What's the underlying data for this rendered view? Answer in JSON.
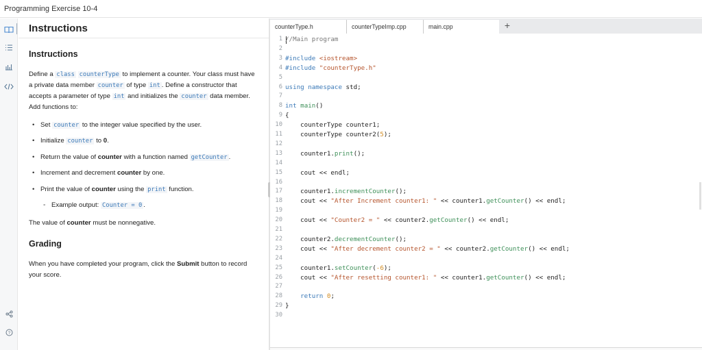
{
  "window": {
    "title": "Programming Exercise 10-4"
  },
  "instructions": {
    "panel_title": "Instructions",
    "heading": "Instructions",
    "intro": [
      {
        "t": "Define a "
      },
      {
        "c": "class"
      },
      {
        "t": " "
      },
      {
        "c": "counterType"
      },
      {
        "t": " to implement a counter. Your class must have a private data member "
      },
      {
        "c": "counter"
      },
      {
        "t": " of type "
      },
      {
        "c": "int"
      },
      {
        "t": ". Define a constructor that accepts a parameter of type "
      },
      {
        "c": "int"
      },
      {
        "t": " and initializes the "
      },
      {
        "c": "counter"
      },
      {
        "t": " data member. Add functions to:"
      }
    ],
    "bullets": [
      {
        "sub": false,
        "parts": [
          {
            "t": "Set "
          },
          {
            "c": "counter"
          },
          {
            "t": " to the integer value specified by the user."
          }
        ]
      },
      {
        "sub": false,
        "parts": [
          {
            "t": "Initialize "
          },
          {
            "c": "counter"
          },
          {
            "t": " to "
          },
          {
            "b": "0"
          },
          {
            "t": "."
          }
        ]
      },
      {
        "sub": false,
        "parts": [
          {
            "t": "Return the value of "
          },
          {
            "b": "counter"
          },
          {
            "t": " with a function named "
          },
          {
            "c": "getCounter"
          },
          {
            "t": "."
          }
        ]
      },
      {
        "sub": false,
        "parts": [
          {
            "t": "Increment and decrement "
          },
          {
            "b": "counter"
          },
          {
            "t": " by one."
          }
        ]
      },
      {
        "sub": false,
        "parts": [
          {
            "t": "Print the value of "
          },
          {
            "b": "counter"
          },
          {
            "t": " using the "
          },
          {
            "c": "print"
          },
          {
            "t": " function."
          }
        ]
      },
      {
        "sub": true,
        "parts": [
          {
            "t": "Example output: "
          },
          {
            "c": "Counter = 0"
          },
          {
            "t": "."
          }
        ]
      }
    ],
    "note": [
      {
        "t": "The value of "
      },
      {
        "b": "counter"
      },
      {
        "t": " must be nonnegative."
      }
    ],
    "grading_heading": "Grading",
    "grading": [
      {
        "t": "When you have completed your program, click the "
      },
      {
        "b": "Submit"
      },
      {
        "t": " button to record your score."
      }
    ]
  },
  "editor": {
    "tabs": [
      {
        "label": "counterType.h",
        "active": false
      },
      {
        "label": "counterTypeImp.cpp",
        "active": false
      },
      {
        "label": "main.cpp",
        "active": true
      }
    ],
    "add_tab_label": "+",
    "lines": [
      [
        [
          "cmt",
          "//Main program"
        ]
      ],
      [],
      [
        [
          "pp",
          "#include "
        ],
        [
          "str",
          "<iostream>"
        ]
      ],
      [
        [
          "pp",
          "#include "
        ],
        [
          "str",
          "\"counterType.h\""
        ]
      ],
      [],
      [
        [
          "kw",
          "using namespace"
        ],
        [
          "",
          " std;"
        ]
      ],
      [],
      [
        [
          "kw",
          "int"
        ],
        [
          "",
          " "
        ],
        [
          "fn",
          "main"
        ],
        [
          "",
          "()"
        ]
      ],
      [
        [
          "",
          "{"
        ]
      ],
      [
        [
          "",
          "    counterType counter1;"
        ]
      ],
      [
        [
          "",
          "    counterType counter2("
        ],
        [
          "num",
          "5"
        ],
        [
          "",
          ");"
        ]
      ],
      [],
      [
        [
          "",
          "    counter1."
        ],
        [
          "fn",
          "print"
        ],
        [
          "",
          "();"
        ]
      ],
      [],
      [
        [
          "",
          "    cout << endl;"
        ]
      ],
      [],
      [
        [
          "",
          "    counter1."
        ],
        [
          "fn",
          "incrementCounter"
        ],
        [
          "",
          "();"
        ]
      ],
      [
        [
          "",
          "    cout << "
        ],
        [
          "str",
          "\"After Increment counter1: \""
        ],
        [
          "",
          " << counter1."
        ],
        [
          "fn",
          "getCounter"
        ],
        [
          "",
          "() << endl;"
        ]
      ],
      [],
      [
        [
          "",
          "    cout << "
        ],
        [
          "str",
          "\"Counter2 = \""
        ],
        [
          "",
          " << counter2."
        ],
        [
          "fn",
          "getCounter"
        ],
        [
          "",
          "() << endl;"
        ]
      ],
      [],
      [
        [
          "",
          "    counter2."
        ],
        [
          "fn",
          "decrementCounter"
        ],
        [
          "",
          "();"
        ]
      ],
      [
        [
          "",
          "    cout << "
        ],
        [
          "str",
          "\"After decrement counter2 = \""
        ],
        [
          "",
          " << counter2."
        ],
        [
          "fn",
          "getCounter"
        ],
        [
          "",
          "() << endl;"
        ]
      ],
      [],
      [
        [
          "",
          "    counter1."
        ],
        [
          "fn",
          "setCounter"
        ],
        [
          "",
          "("
        ],
        [
          "num",
          "-6"
        ],
        [
          "",
          ");"
        ]
      ],
      [
        [
          "",
          "    cout << "
        ],
        [
          "str",
          "\"After resetting counter1: \""
        ],
        [
          "",
          " << counter1."
        ],
        [
          "fn",
          "getCounter"
        ],
        [
          "",
          "() << endl;"
        ]
      ],
      [],
      [
        [
          "",
          "    "
        ],
        [
          "kw",
          "return"
        ],
        [
          "",
          " "
        ],
        [
          "num",
          "0"
        ],
        [
          "",
          ";"
        ]
      ],
      [
        [
          "",
          "}"
        ]
      ],
      []
    ]
  },
  "rail_icons": [
    "book-icon",
    "list-icon",
    "chart-icon",
    "code-icon",
    "share-icon",
    "help-icon"
  ],
  "colors": {
    "accent": "#3c7ab8",
    "string": "#b5542c",
    "number": "#d18b20",
    "function": "#3d8f58"
  }
}
